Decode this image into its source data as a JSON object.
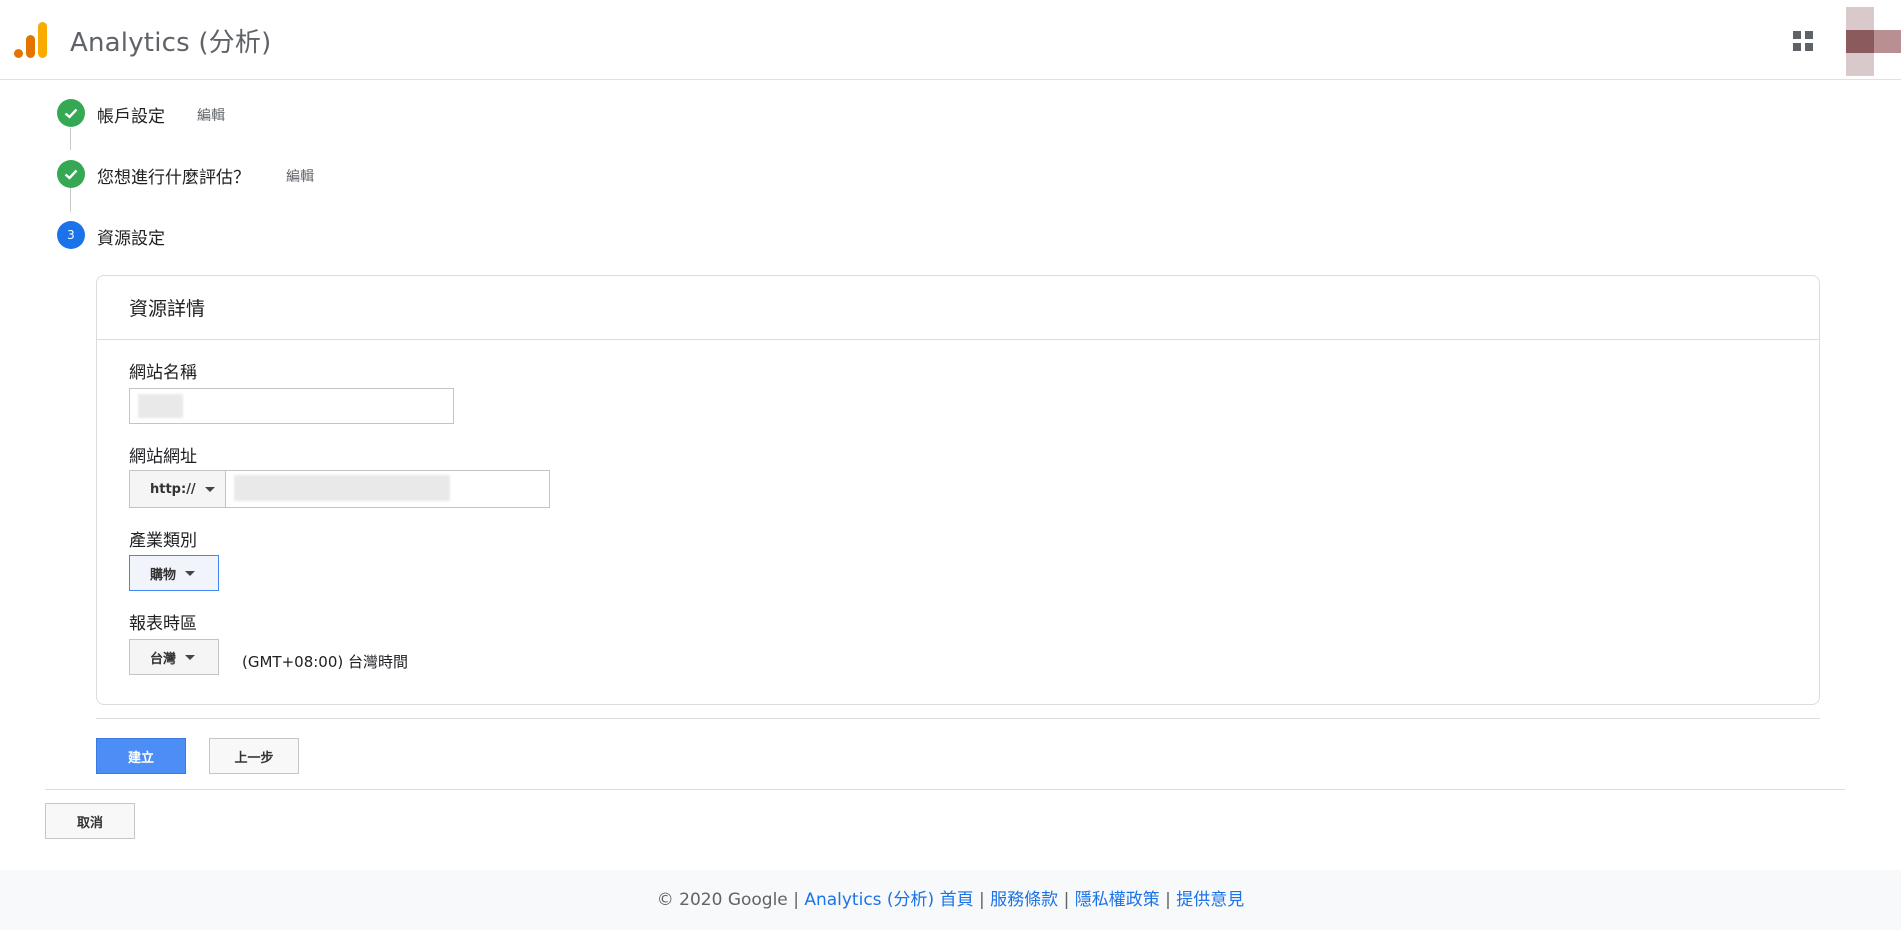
{
  "header": {
    "app_title": "Analytics (分析)",
    "logo_colors": [
      "#f9ab00",
      "#e37400"
    ]
  },
  "stepper": {
    "steps": [
      {
        "label": "帳戶設定",
        "status": "done",
        "edit_label": "編輯"
      },
      {
        "label": "您想進行什麼評估？",
        "status": "done",
        "edit_label": "編輯"
      },
      {
        "number": "3",
        "label": "資源設定",
        "status": "active"
      }
    ]
  },
  "form": {
    "card_title": "資源詳情",
    "site_name": {
      "label": "網站名稱",
      "value": ""
    },
    "site_url": {
      "label": "網站網址",
      "protocol": "http://",
      "value": ""
    },
    "industry": {
      "label": "產業類別",
      "selected": "購物"
    },
    "timezone": {
      "label": "報表時區",
      "country": "台灣",
      "zone_text": "(GMT+08:00) 台灣時間"
    }
  },
  "actions": {
    "create_label": "建立",
    "back_label": "上一步",
    "cancel_label": "取消"
  },
  "footer": {
    "copyright": "© 2020 Google",
    "separator": "|",
    "links": [
      "Analytics (分析) 首頁",
      "服務條款",
      "隱私權政策",
      "提供意見"
    ]
  },
  "colors": {
    "primary_blue": "#4d8ef6",
    "success_green": "#34a853",
    "link_blue": "#1a73e8"
  }
}
